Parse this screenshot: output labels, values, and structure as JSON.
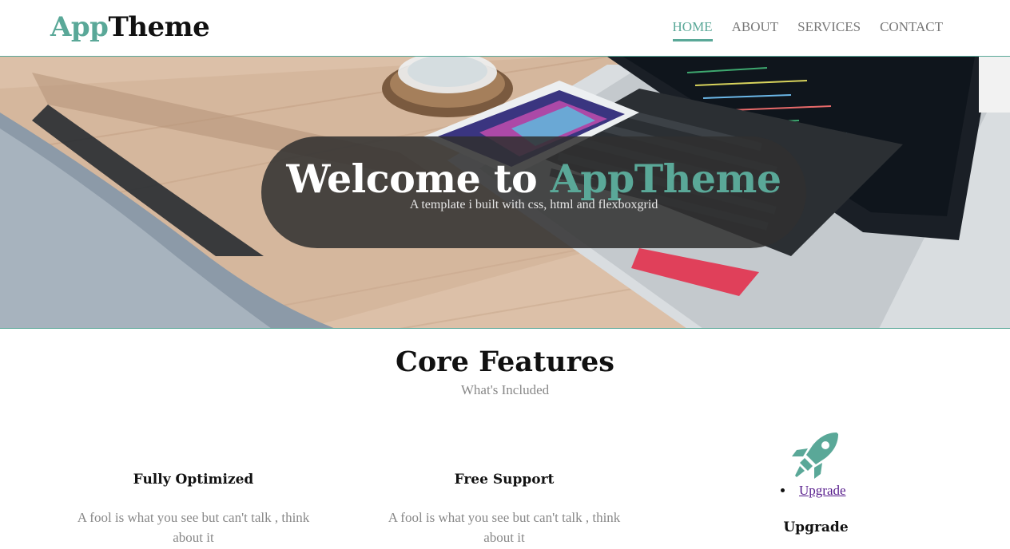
{
  "header": {
    "logo_accent": "App",
    "logo_rest": "Theme",
    "nav": [
      {
        "label": "HOME",
        "active": true
      },
      {
        "label": "ABOUT",
        "active": false
      },
      {
        "label": "SERVICES",
        "active": false
      },
      {
        "label": "CONTACT",
        "active": false
      }
    ]
  },
  "hero": {
    "title_prefix": "Welcome to",
    "title_accent": "AppTheme",
    "subtitle": "A template i built with css, html and flexboxgrid"
  },
  "features": {
    "title": "Core Features",
    "subtitle": "What's Included",
    "items": [
      {
        "heading": "Fully Optimized",
        "text": "A fool is what you see but can't talk , think about it"
      },
      {
        "heading": "Free Support",
        "text": "A fool is what you see but can't talk , think about it"
      },
      {
        "heading": "Upgrade",
        "link_label": "Upgrade",
        "icon": "rocket-icon"
      }
    ]
  },
  "colors": {
    "accent": "#5aa898",
    "text_dark": "#111111",
    "text_muted": "#888888",
    "link": "#551a8b"
  }
}
